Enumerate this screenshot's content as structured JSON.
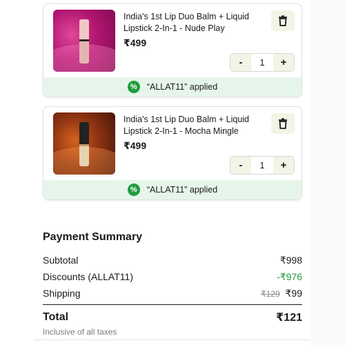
{
  "cart": {
    "items": [
      {
        "title": "India's 1st Lip Duo Balm + Liquid Lipstick 2-In-1 - Nude Play",
        "price": "₹499",
        "quantity": "1",
        "coupon_text": "“ALLAT11” applied"
      },
      {
        "title": "India's 1st Lip Duo Balm + Liquid Lipstick 2-In-1 - Mocha Mingle",
        "price": "₹499",
        "quantity": "1",
        "coupon_text": "“ALLAT11” applied"
      }
    ],
    "minus_label": "-",
    "plus_label": "+",
    "icons": {
      "delete": "trash-icon",
      "coupon": "percent-badge-icon"
    }
  },
  "summary": {
    "title": "Payment Summary",
    "subtotal_label": "Subtotal",
    "subtotal_value": "₹998",
    "discount_label": "Discounts (ALLAT11)",
    "discount_value": "-₹976",
    "shipping_label": "Shipping",
    "shipping_old_value": "₹129",
    "shipping_value": "₹99",
    "total_label": "Total",
    "total_value": "₹121",
    "taxes_note": "Inclusive of all taxes"
  },
  "colors": {
    "accent_green": "#1f9d3d",
    "coupon_bg": "#e6f5ea",
    "button_bg": "#f3f3e6"
  }
}
